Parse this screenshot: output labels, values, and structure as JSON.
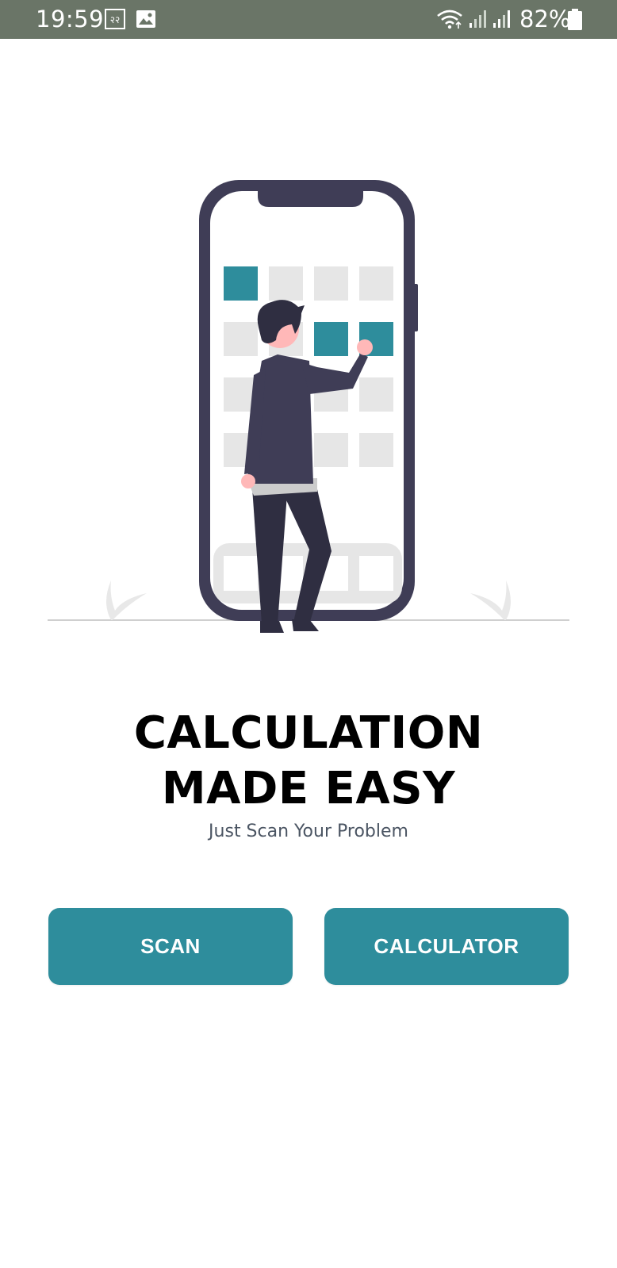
{
  "status_bar": {
    "time": "19:59",
    "battery_percent": "82%",
    "icons": [
      "rr-icon",
      "image-icon",
      "wifi-icon",
      "signal-icon",
      "signal-icon",
      "battery-icon"
    ],
    "background_color": "#6a7567"
  },
  "illustration": {
    "name": "person-pressing-phone-keypad-illustration",
    "accent_color": "#2e8d9c",
    "dark_color": "#3f3d56"
  },
  "main": {
    "headline_line1": "CALCULATION",
    "headline_line2": "MADE EASY",
    "subtitle": "Just Scan Your Problem"
  },
  "actions": {
    "scan_label": "SCAN",
    "calculator_label": "CALCULATOR",
    "button_color": "#2e8d9c"
  }
}
